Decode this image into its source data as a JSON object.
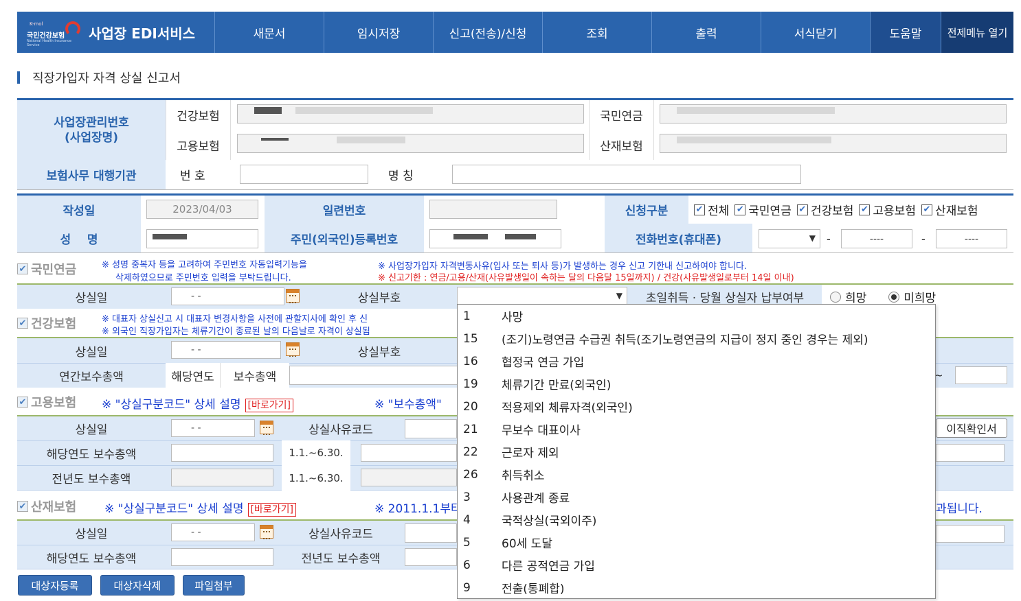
{
  "nav": {
    "logo_ko": "국민건강보험",
    "logo_small": "K-mol",
    "logo_en": "National Health Insurance Service",
    "title": "사업장 EDI서비스",
    "items": [
      "새문서",
      "임시저장",
      "신고(전송)/신청",
      "조회",
      "출력",
      "서식닫기"
    ],
    "help": "도움말",
    "menu_open": "전제메뉴 열기"
  },
  "page_title": "직장가입자 자격 상실 신고서",
  "header": {
    "biz_label": "사업장관리번호\n(사업장명)",
    "health": "건강보험",
    "pension": "국민연금",
    "employment": "고용보험",
    "accident": "산재보험",
    "agency_label": "보험사무 대행기관",
    "number_label": "번 호",
    "name_label": "명 칭"
  },
  "person": {
    "written_label": "작성일",
    "written_value": "2023/04/03",
    "serial_label": "일련번호",
    "apply_label": "신청구분",
    "apply_options": [
      "전체",
      "국민연금",
      "건강보험",
      "고용보험",
      "산재보험"
    ],
    "name_label": "성    명",
    "rrn_label": "주민(외국인)등록번호",
    "phone_label": "전화번호(휴대폰)",
    "phone_dash": "-",
    "phone_mid": "----",
    "phone_last": "----"
  },
  "pension": {
    "title": "국민연금",
    "note1": "※ 성명 중복자 등을 고려하여 주민번호 자동입력기능을",
    "note1b": "삭제하였으므로 주민번호 입력을 부탁드립니다.",
    "note2": "※ 사업장가입자 자격변동사유(입사 또는 퇴사 등)가 발생하는 경우 신고 기한내 신고하여야 합니다.",
    "note3": "※ 신고기한 : 연금/고용/산재(사유발생일이 속하는 달의 다음달 15일까지) / 건강(사유발생일로부터 14일 이내)",
    "loss_date": "상실일",
    "date_value": "-  -",
    "loss_code": "상실부호",
    "first_month": "초일취득 · 당월 상실자 납부여부",
    "hope": "희망",
    "no_hope": "미희망"
  },
  "health": {
    "title": "건강보험",
    "note1": "※ 대표자 상실신고 시 대표자 변경사항을 사전에 관할지사에 확인 후 신",
    "note2": "※ 외국인 직장가입자는 체류기간이 종료된 날의 다음날로 자격이 상실됨",
    "loss_date": "상실일",
    "loss_code": "상실부호",
    "annual": "연간보수총액",
    "this_year": "해당연도",
    "total": "보수총액",
    "tail": "~"
  },
  "employment": {
    "title": "고용보험",
    "desc": "※ \"상실구분코드\" 상세 설명",
    "goto": "[바로가기]",
    "desc2": "※ \"보수총액\"",
    "loss_date": "상실일",
    "reason_code": "상실사유코드",
    "confirm_btn": "이직확인서",
    "this_year_total": "해당연도 보수총액",
    "last_year_total": "전년도 보수총액",
    "period1": "1.1.~6.30.",
    "period2": "1.1.~6.30."
  },
  "accident": {
    "title": "산재보험",
    "desc": "※ \"상실구분코드\" 상세 설명",
    "goto": "[바로가기]",
    "desc2": "※ 2011.1.1부터",
    "desc3": "과됩니다.",
    "loss_date": "상실일",
    "reason_code": "상실사유코드",
    "this_year_total": "해당연도 보수총액",
    "last_year_total": "전년도 보수총액"
  },
  "buttons": {
    "register": "대상자등록",
    "delete": "대상자삭제",
    "attach": "파일첨부"
  },
  "dropdown": [
    {
      "code": "1",
      "text": "사망"
    },
    {
      "code": "15",
      "text": "(조기)노령연금 수급권 취득(조기노령연금의 지급이 정지 중인 경우는 제외)"
    },
    {
      "code": "16",
      "text": "협정국 연금 가입"
    },
    {
      "code": "19",
      "text": "체류기간 만료(외국인)"
    },
    {
      "code": "20",
      "text": "적용제외 체류자격(외국인)"
    },
    {
      "code": "21",
      "text": "무보수 대표이사"
    },
    {
      "code": "22",
      "text": "근로자 제외"
    },
    {
      "code": "26",
      "text": "취득취소"
    },
    {
      "code": "3",
      "text": "사용관계 종료"
    },
    {
      "code": "4",
      "text": "국적상실(국외이주)"
    },
    {
      "code": "5",
      "text": "60세 도달"
    },
    {
      "code": "6",
      "text": "다른 공적연금 가입"
    },
    {
      "code": "9",
      "text": "전출(통폐합)"
    }
  ],
  "colors": {
    "nav": "#2a64ad",
    "label_bg": "#dde9f7",
    "note_blue": "#1a3fd0",
    "note_red": "#e02020"
  }
}
